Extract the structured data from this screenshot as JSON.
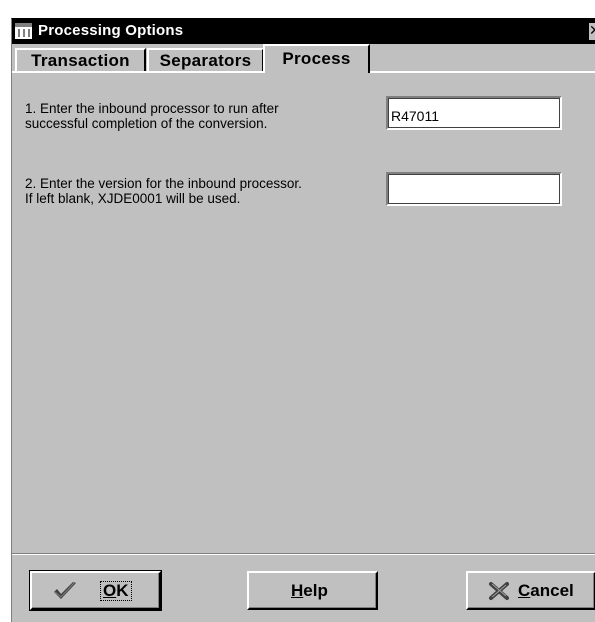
{
  "window": {
    "title": "Processing Options",
    "close_glyph": "✕"
  },
  "tabs": [
    {
      "label": "Transaction",
      "active": false
    },
    {
      "label": "Separators",
      "active": false
    },
    {
      "label": "Process",
      "active": true
    }
  ],
  "options": [
    {
      "prompt_line1": "1. Enter the inbound processor to run after",
      "prompt_line2": "successful completion of the conversion.",
      "value": "R47011"
    },
    {
      "prompt_line1": "2. Enter the version for the inbound processor.",
      "prompt_line2": "If left blank, XJDE0001 will be used.",
      "value": ""
    }
  ],
  "buttons": {
    "ok": {
      "label": "OK",
      "mnemonic": "O",
      "rest": "K",
      "icon": "checkmark-icon"
    },
    "help": {
      "label": "Help",
      "mnemonic": "H",
      "rest": "elp"
    },
    "cancel": {
      "label": "Cancel",
      "mnemonic": "C",
      "rest": "ancel",
      "icon": "x-icon"
    }
  },
  "colors": {
    "dialog_face": "#c0c0c0",
    "titlebar": "#000000",
    "field_bg": "#ffffff"
  }
}
